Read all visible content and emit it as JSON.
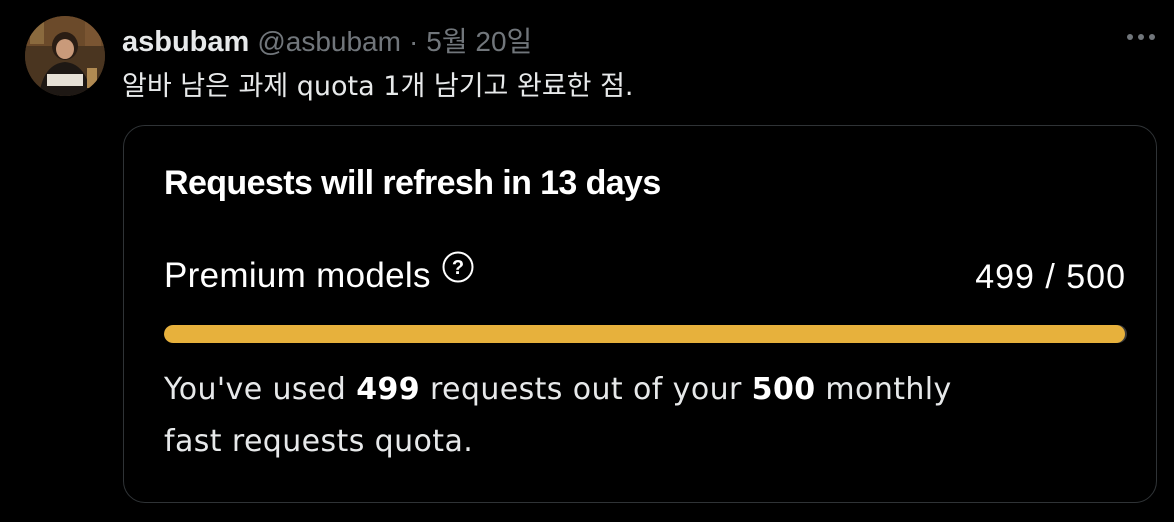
{
  "tweet": {
    "avatar_icon": "user-avatar-photo",
    "display_name": "asbubam",
    "handle": "@asbubam",
    "separator": "·",
    "date": "5월 20일",
    "more_icon": "more-horizontal-icon",
    "text": "알바 남은 과제 quota 1개 남기고 완료한 점."
  },
  "card": {
    "title": "Requests will refresh in 13 days",
    "quota_label": "Premium models",
    "help_icon": "question-circle-icon",
    "used": 499,
    "limit": 500,
    "count_text": "499 / 500",
    "progress_fraction": 0.998,
    "description": {
      "prefix": "You've used ",
      "used": "499",
      "middle": " requests out of your ",
      "limit": "500",
      "suffix_line1": " monthly",
      "line2": "fast requests quota."
    }
  },
  "colors": {
    "background": "#000000",
    "card_border": "#2f3336",
    "muted_text": "#71767b",
    "primary_text": "#e7e9ea",
    "progress_fill": "#e7b13c",
    "progress_track": "#3a3a3a"
  }
}
